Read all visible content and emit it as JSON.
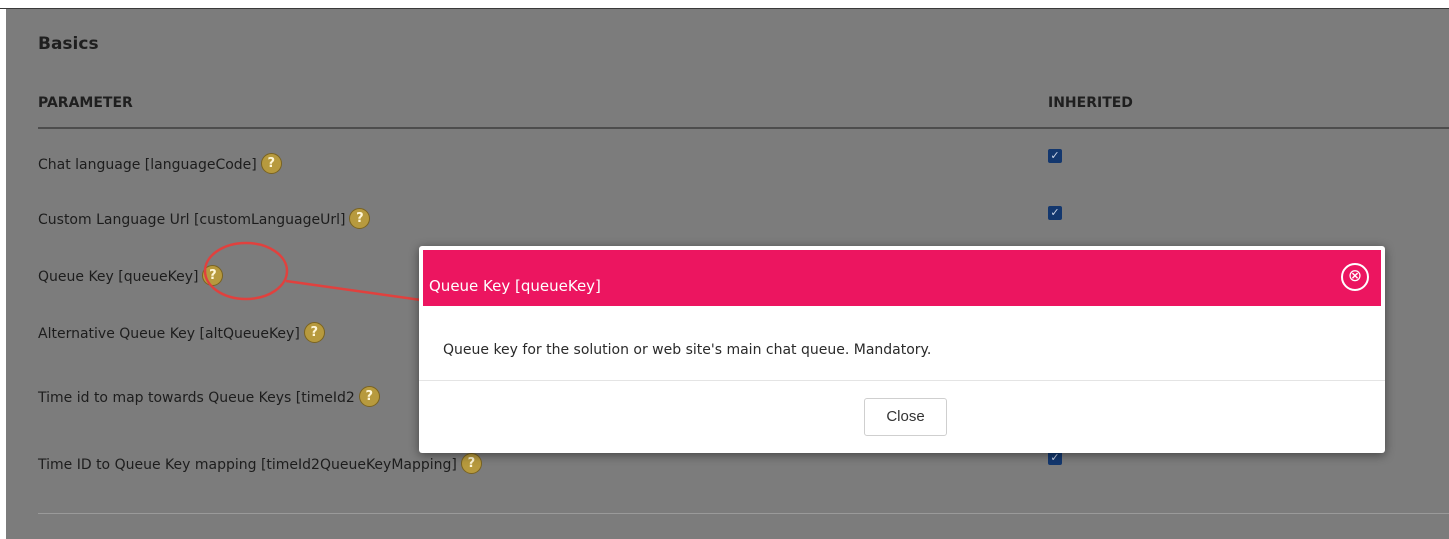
{
  "section": {
    "title": "Basics"
  },
  "table": {
    "columns": {
      "parameter": "PARAMETER",
      "inherited": "INHERITED"
    },
    "rows": [
      {
        "label": "Chat language [languageCode]",
        "help": "?",
        "inherited": true
      },
      {
        "label": "Custom Language Url [customLanguageUrl]",
        "help": "?",
        "inherited": true
      },
      {
        "label": "Queue Key [queueKey]",
        "help": "?",
        "inherited": true
      },
      {
        "label": "Alternative Queue Key [altQueueKey]",
        "help": "?",
        "inherited": true
      },
      {
        "label": "Time id to map towards Queue Keys [timeId2",
        "help": "?",
        "inherited": true
      },
      {
        "label": "Time ID to Queue Key mapping [timeId2QueueKeyMapping]",
        "help": "?",
        "inherited": true
      }
    ]
  },
  "modal": {
    "title": "Queue Key [queueKey]",
    "close_icon": "⊗",
    "body": "Queue key for the solution or web site's main chat queue. Mandatory.",
    "close_label": "Close"
  },
  "colors": {
    "modal_header": "#ec1560",
    "overlay": "#7c7c7c",
    "checkbox": "#13376e",
    "help_icon": "#b79a3e",
    "annotation": "#e0413e"
  },
  "icons": {
    "help": "question-circle-icon",
    "checkbox_mark": "✓",
    "close": "circle-x-icon"
  }
}
